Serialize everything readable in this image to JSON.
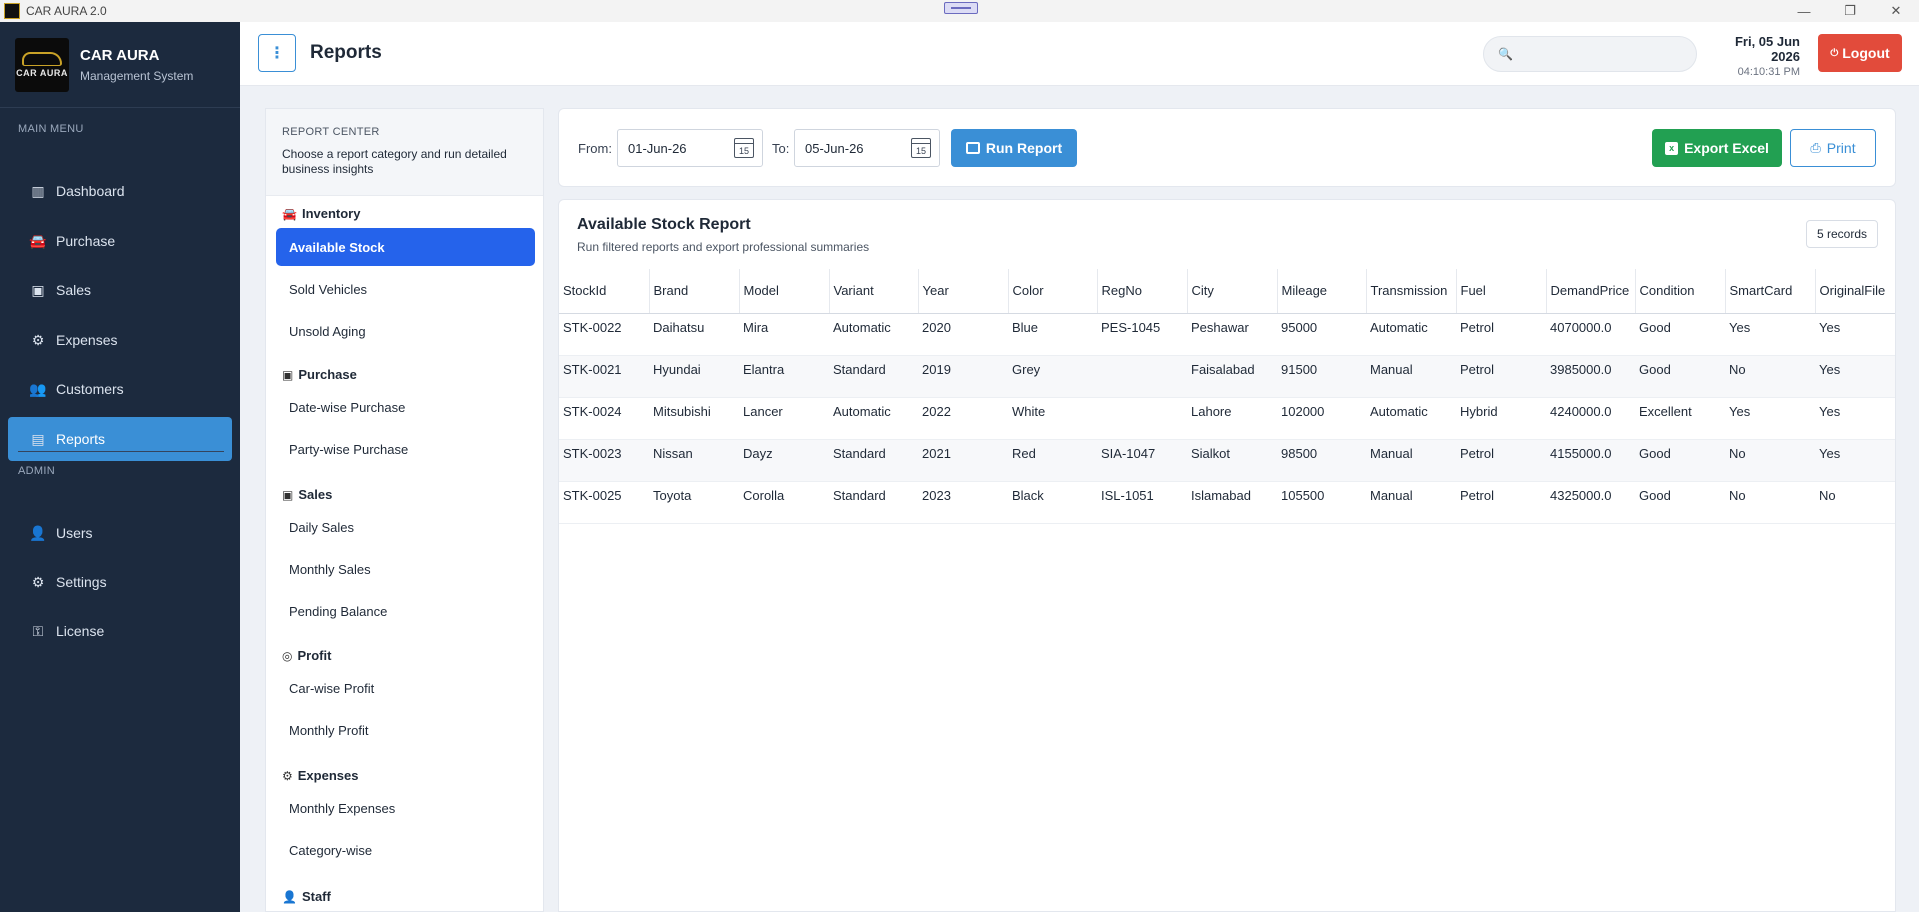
{
  "window": {
    "title": "CAR AURA 2.0",
    "controls": {
      "minimize": "—",
      "restore": "❐",
      "close": "✕"
    }
  },
  "brand": {
    "logo_text": "CAR AURA",
    "title": "CAR AURA",
    "subtitle": "Management System"
  },
  "sidebar": {
    "main_heading": "MAIN MENU",
    "admin_heading": "ADMIN",
    "main_items": [
      {
        "label": "Dashboard",
        "icon": "chart-icon",
        "glyph": "▥"
      },
      {
        "label": "Purchase",
        "icon": "car-icon",
        "glyph": "🚘"
      },
      {
        "label": "Sales",
        "icon": "sales-icon",
        "glyph": "▣"
      },
      {
        "label": "Expenses",
        "icon": "expenses-icon",
        "glyph": "⚙"
      },
      {
        "label": "Customers",
        "icon": "customers-icon",
        "glyph": "👥"
      },
      {
        "label": "Reports",
        "icon": "reports-icon",
        "glyph": "▤"
      }
    ],
    "admin_items": [
      {
        "label": "Users",
        "icon": "user-icon",
        "glyph": "👤"
      },
      {
        "label": "Settings",
        "icon": "gear-icon",
        "glyph": "⚙"
      },
      {
        "label": "License",
        "icon": "key-icon",
        "glyph": "⚿"
      }
    ],
    "active": "Reports"
  },
  "header": {
    "menu_toggle_glyph": "⋮",
    "page_title": "Reports",
    "search_placeholder": "",
    "search_glyph": "🔍",
    "date": "Fri, 05 Jun 2026",
    "time": "04:10:31 PM",
    "logout_label": "Logout",
    "logout_glyph": "⏻"
  },
  "report_center": {
    "title": "REPORT CENTER",
    "description": "Choose a report category and run detailed business insights",
    "categories": [
      {
        "name": "Inventory",
        "glyph": "🚘",
        "items": [
          "Available Stock",
          "Sold Vehicles",
          "Unsold Aging"
        ]
      },
      {
        "name": "Purchase",
        "glyph": "▣",
        "items": [
          "Date-wise Purchase",
          "Party-wise Purchase"
        ]
      },
      {
        "name": "Sales",
        "glyph": "▣",
        "items": [
          "Daily Sales",
          "Monthly Sales",
          "Pending Balance"
        ]
      },
      {
        "name": "Profit",
        "glyph": "◎",
        "items": [
          "Car-wise Profit",
          "Monthly Profit"
        ]
      },
      {
        "name": "Expenses",
        "glyph": "⚙",
        "items": [
          "Monthly Expenses",
          "Category-wise"
        ]
      },
      {
        "name": "Staff",
        "glyph": "👤",
        "items": []
      }
    ],
    "active_item": "Available Stock"
  },
  "filters": {
    "from_label": "From:",
    "from_value": "01-Jun-26",
    "to_label": "To:",
    "to_value": "05-Jun-26",
    "calendar_glyph": "15",
    "run_label": "Run Report",
    "export_label": "Export Excel",
    "export_glyph": "x",
    "print_label": "Print",
    "print_glyph": "⎙"
  },
  "report": {
    "title": "Available Stock Report",
    "subtitle": "Run filtered reports and export professional summaries",
    "records": "5 records",
    "columns": [
      "StockId",
      "Brand",
      "Model",
      "Variant",
      "Year",
      "Color",
      "RegNo",
      "City",
      "Mileage",
      "Transmission",
      "Fuel",
      "DemandPrice",
      "Condition",
      "SmartCard",
      "OriginalFile"
    ],
    "rows": [
      [
        "STK-0022",
        "Daihatsu",
        "Mira",
        "Automatic",
        "2020",
        "Blue",
        "PES-1045",
        "Peshawar",
        "95000",
        "Automatic",
        "Petrol",
        "4070000.0",
        "Good",
        "Yes",
        "Yes"
      ],
      [
        "STK-0021",
        "Hyundai",
        "Elantra",
        "Standard",
        "2019",
        "Grey",
        "",
        "Faisalabad",
        "91500",
        "Manual",
        "Petrol",
        "3985000.0",
        "Good",
        "No",
        "Yes"
      ],
      [
        "STK-0024",
        "Mitsubishi",
        "Lancer",
        "Automatic",
        "2022",
        "White",
        "",
        "Lahore",
        "102000",
        "Automatic",
        "Hybrid",
        "4240000.0",
        "Excellent",
        "Yes",
        "Yes"
      ],
      [
        "STK-0023",
        "Nissan",
        "Dayz",
        "Standard",
        "2021",
        "Red",
        "SIA-1047",
        "Sialkot",
        "98500",
        "Manual",
        "Petrol",
        "4155000.0",
        "Good",
        "No",
        "Yes"
      ],
      [
        "STK-0025",
        "Toyota",
        "Corolla",
        "Standard",
        "2023",
        "Black",
        "ISL-1051",
        "Islamabad",
        "105500",
        "Manual",
        "Petrol",
        "4325000.0",
        "Good",
        "No",
        "No"
      ]
    ]
  },
  "colors": {
    "sidebar_bg": "#1c2a3e",
    "sidebar_active": "#3a8fd6",
    "report_active": "#2563eb",
    "run_button": "#3a8fd6",
    "export_button": "#22a052",
    "logout_button": "#e24b3b"
  }
}
